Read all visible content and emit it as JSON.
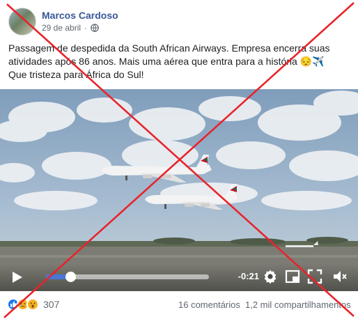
{
  "post": {
    "author": "Marcos Cardoso",
    "date": "29 de abril",
    "separator": "·",
    "text_lines": [
      "Passagem de despedida da South African Airways. Empresa encerra suas",
      "atividades após 86 anos. Mais uma aérea que entra para a história 😔✈️",
      "Que tristeza para África do Sul!"
    ]
  },
  "video": {
    "time_remaining": "-0:21",
    "progress_fraction": 0.15
  },
  "footer": {
    "reaction_count": "307",
    "reactions": [
      "like-icon",
      "sad-icon",
      "wow-icon"
    ],
    "comments": "16 comentários",
    "shares": "1,2 mil compartilhamentos"
  },
  "colors": {
    "author": "#385898",
    "muted": "#606770",
    "cross": "#e8242b",
    "progress": "#4a76d6"
  },
  "icons": [
    "globe-icon",
    "play-icon",
    "settings-icon",
    "pip-icon",
    "fullscreen-icon",
    "volume-icon"
  ]
}
